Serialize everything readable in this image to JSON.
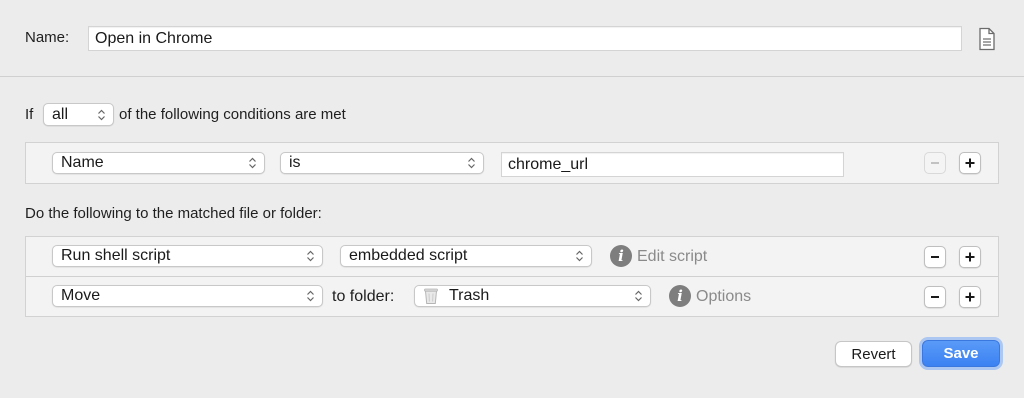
{
  "header": {
    "name_label": "Name:",
    "name_value": "Open in Chrome"
  },
  "conditions": {
    "prefix": "If",
    "match_mode": "all",
    "suffix": "of the following conditions are met",
    "rows": [
      {
        "attribute": "Name",
        "operator": "is",
        "value": "chrome_url"
      }
    ]
  },
  "actions": {
    "heading": "Do the following to the matched file or folder:",
    "rows": [
      {
        "action": "Run shell script",
        "target": "embedded script",
        "link": "Edit script"
      },
      {
        "action": "Move",
        "connector": "to folder:",
        "target": "Trash",
        "link": "Options"
      }
    ]
  },
  "footer": {
    "revert_label": "Revert",
    "save_label": "Save"
  },
  "colors": {
    "accent": "#3b82f2",
    "background": "#ececec"
  },
  "icons": {
    "document": "document-icon",
    "info": "info-icon",
    "minus": "minus-icon",
    "plus": "plus-icon",
    "trash": "trash-icon",
    "chevron": "chevron-updown-icon"
  }
}
